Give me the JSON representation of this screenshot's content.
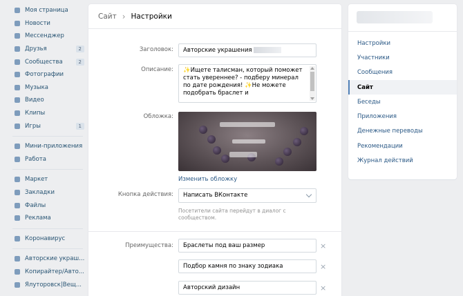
{
  "nav": {
    "items": [
      {
        "label": "Моя страница",
        "icon": "user-icon",
        "count": ""
      },
      {
        "label": "Новости",
        "icon": "news-icon",
        "count": ""
      },
      {
        "label": "Мессенджер",
        "icon": "message-icon",
        "count": ""
      },
      {
        "label": "Друзья",
        "icon": "friends-icon",
        "count": "2"
      },
      {
        "label": "Сообщества",
        "icon": "groups-icon",
        "count": "2"
      },
      {
        "label": "Фотографии",
        "icon": "camera-icon",
        "count": ""
      },
      {
        "label": "Музыка",
        "icon": "music-icon",
        "count": ""
      },
      {
        "label": "Видео",
        "icon": "video-icon",
        "count": ""
      },
      {
        "label": "Клипы",
        "icon": "clips-icon",
        "count": ""
      },
      {
        "label": "Игры",
        "icon": "gamepad-icon",
        "count": "1"
      }
    ],
    "items2": [
      {
        "label": "Мини-приложения",
        "icon": "apps-icon"
      },
      {
        "label": "Работа",
        "icon": "briefcase-icon"
      }
    ],
    "items3": [
      {
        "label": "Маркет",
        "icon": "market-icon"
      },
      {
        "label": "Закладки",
        "icon": "bookmark-icon"
      },
      {
        "label": "Файлы",
        "icon": "file-icon"
      },
      {
        "label": "Реклама",
        "icon": "ads-icon"
      }
    ],
    "items4": [
      {
        "label": "Коронавирус",
        "icon": "virus-icon"
      }
    ],
    "items5": [
      {
        "label": "Авторские украш...",
        "icon": "group-icon"
      },
      {
        "label": "Копирайтер/Авто...",
        "icon": "group-icon"
      },
      {
        "label": "Ялуторовск|Вещ...",
        "icon": "group-icon"
      }
    ]
  },
  "breadcrumb": {
    "parent": "Сайт",
    "separator": "›",
    "current": "Настройки"
  },
  "form": {
    "title_label": "Заголовок:",
    "title_value": "Авторские украшения",
    "description_label": "Описание:",
    "description_value": "✨Ищете талисман, который поможет стать увереннее? - подберу минерал по дате рождения! ✨Не можете подобрать браслет и",
    "cover_label": "Обложка:",
    "cover_link": "Изменить обложку",
    "action_label": "Кнопка действия:",
    "action_value": "Написать ВКонтакте",
    "action_hint": "Посетители сайта перейдут в диалог с сообществом.",
    "advantages_label": "Преимущества:",
    "advantages": [
      "Браслеты под ваш размер",
      "Подбор камня по знаку зодиака",
      "Авторский дизайн"
    ],
    "remove_symbol": "×"
  },
  "side_menu": {
    "items": [
      "Настройки",
      "Участники",
      "Сообщения",
      "Сайт",
      "Беседы",
      "Приложения",
      "Денежные переводы",
      "Рекомендации",
      "Журнал действий"
    ],
    "active_index": 3
  },
  "colors": {
    "accent": "#5181b8",
    "link": "#2a5885",
    "background": "#edeef0"
  }
}
